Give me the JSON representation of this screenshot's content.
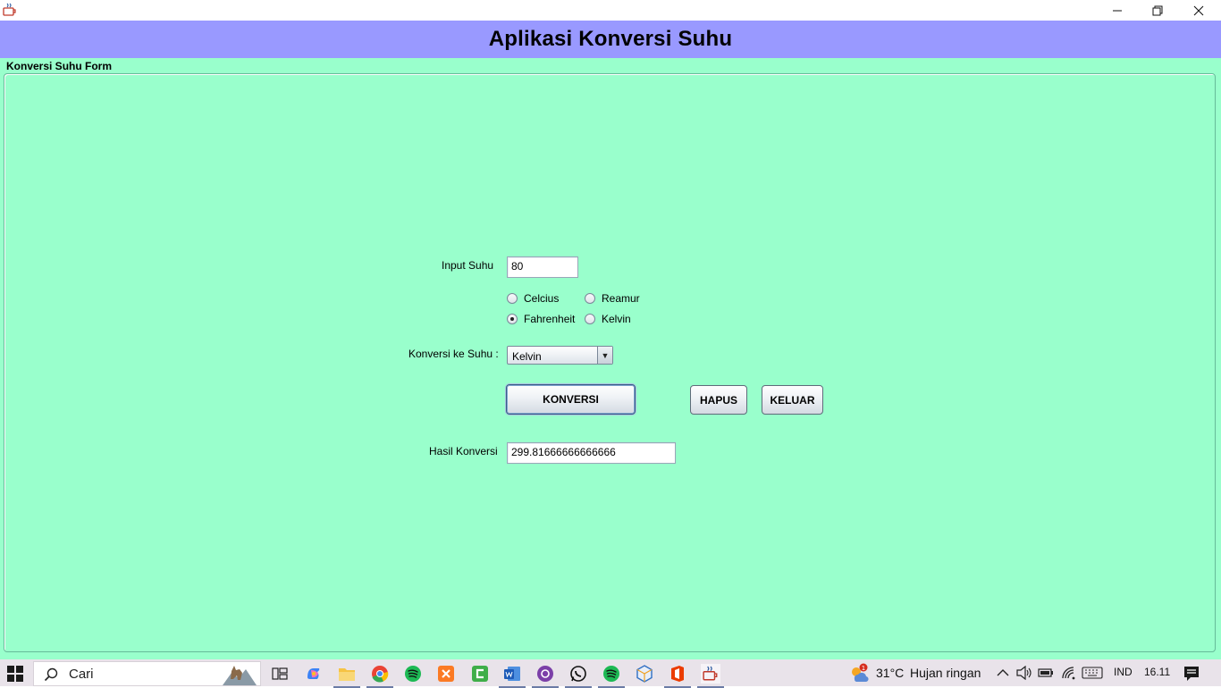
{
  "window": {
    "title": "Aplikasi Konversi Suhu",
    "controls": {
      "minimize": "minimize-icon",
      "restore": "restore-icon",
      "close": "close-icon"
    }
  },
  "form": {
    "title": "Konversi Suhu Form",
    "input_label": "Input Suhu",
    "input_value": "80",
    "source_units": [
      {
        "label": "Celcius",
        "checked": false
      },
      {
        "label": "Reamur",
        "checked": false
      },
      {
        "label": "Fahrenheit",
        "checked": true
      },
      {
        "label": "Kelvin",
        "checked": false
      }
    ],
    "target_label": "Konversi ke Suhu :",
    "target_value": "Kelvin",
    "buttons": {
      "convert": "KONVERSI",
      "clear": "HAPUS",
      "exit": "KELUAR"
    },
    "result_label": "Hasil Konversi",
    "result_value": "299.81666666666666"
  },
  "taskbar": {
    "search_placeholder": "Cari",
    "apps": [
      "task-view",
      "copilot",
      "file-explorer",
      "chrome",
      "spotify",
      "xampp",
      "camtasia",
      "word",
      "github-desktop",
      "whatsapp",
      "spotify",
      "virtualbox",
      "office",
      "java"
    ],
    "weather": {
      "temperature": "31°C",
      "condition": "Hujan ringan",
      "alerts": "1"
    },
    "language": "IND",
    "time": "16.11"
  },
  "colors": {
    "header_bg": "#9999ff",
    "form_bg": "#99ffcc",
    "taskbar_bg": "#e9e3ea"
  }
}
